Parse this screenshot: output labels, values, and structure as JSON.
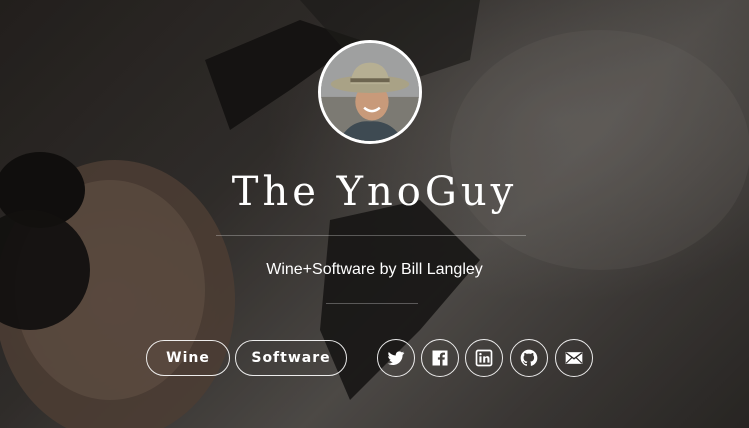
{
  "header": {
    "title": "The YnoGuy",
    "tagline": "Wine+Software by Bill Langley"
  },
  "nav": {
    "items": [
      {
        "label": "Wine"
      },
      {
        "label": "Software"
      }
    ]
  },
  "social": {
    "icons": [
      "twitter-icon",
      "facebook-icon",
      "linkedin-icon",
      "github-icon",
      "email-icon"
    ]
  },
  "colors": {
    "text": "#ffffff",
    "outline": "#ffffff"
  }
}
